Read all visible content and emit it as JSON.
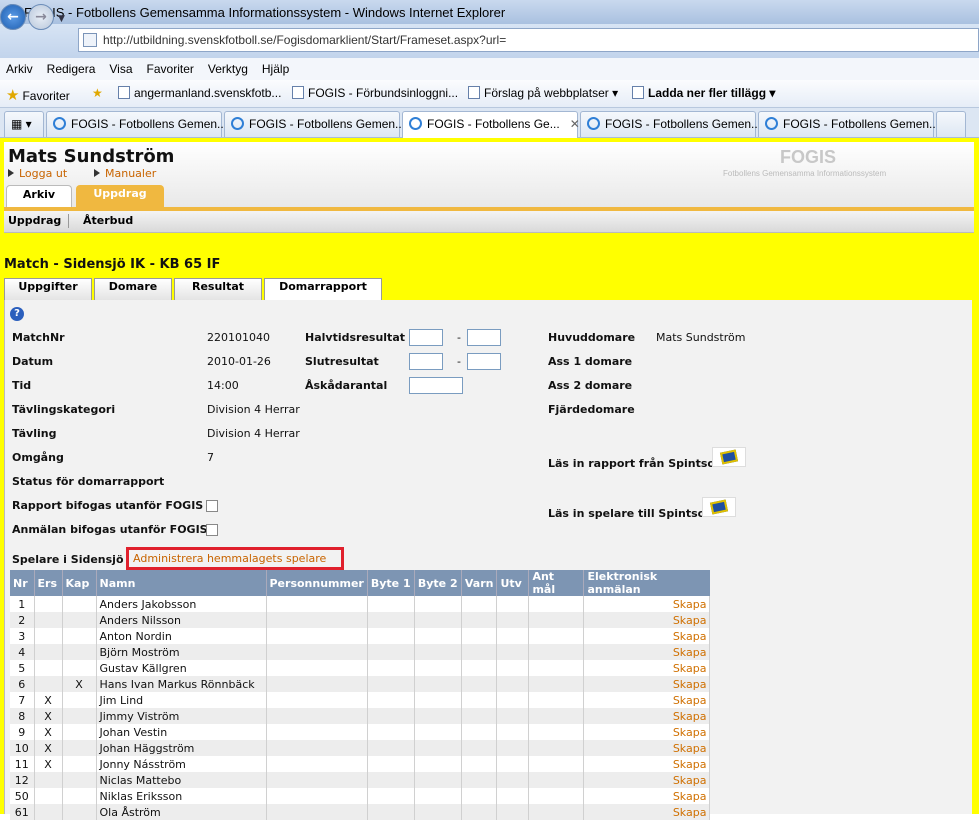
{
  "window": {
    "title": "FOGIS - Fotbollens Gemensamma Informationssystem - Windows Internet Explorer"
  },
  "address": {
    "url": "http://utbildning.svenskfotboll.se/Fogisdomarklient/Start/Frameset.aspx?url="
  },
  "menu": [
    "Arkiv",
    "Redigera",
    "Visa",
    "Favoriter",
    "Verktyg",
    "Hjälp"
  ],
  "favorites": {
    "label": "Favoriter",
    "items": [
      "angermanland.svenskfotb...",
      "FOGIS - Förbundsinloggni...",
      "Förslag på webbplatser ▾",
      "Ladda ner fler tillägg ▾"
    ]
  },
  "tabs": [
    "FOGIS - Fotbollens Gemen...",
    "FOGIS - Fotbollens Gemen...",
    "FOGIS - Fotbollens Ge...",
    "FOGIS - Fotbollens Gemen...",
    "FOGIS - Fotbollens Gemen..."
  ],
  "header": {
    "user": "Mats Sundström",
    "logout": "Logga ut",
    "manuals": "Manualer",
    "logo": "FOGIS",
    "logo_sub": "Fotbollens Gemensamma Informationssystem",
    "tab_arkiv": "Arkiv",
    "tab_uppdrag": "Uppdrag",
    "sub_uppdrag": "Uppdrag",
    "sub_aterbud": "Återbud"
  },
  "match": {
    "title": "Match - Sidensjö IK - KB 65 IF",
    "tabs": [
      "Uppgifter",
      "Domare",
      "Resultat",
      "Domarrapport"
    ]
  },
  "report": {
    "matchnr_label": "MatchNr",
    "matchnr": "220101040",
    "datum_label": "Datum",
    "datum": "2010-01-26",
    "tid_label": "Tid",
    "tid": "14:00",
    "kategori_label": "Tävlingskategori",
    "kategori": "Division 4 Herrar",
    "tavling_label": "Tävling",
    "tavling": "Division 4 Herrar",
    "omgang_label": "Omgång",
    "omgang": "7",
    "status_label": "Status för domarrapport",
    "rapport_label": "Rapport bifogas utanför FOGIS",
    "anmalan_label": "Anmälan bifogas utanför FOGIS",
    "halvtid_label": "Halvtidsresultat",
    "slut_label": "Slutresultat",
    "askadar_label": "Åskådarantal",
    "dash": "-",
    "huvud_label": "Huvuddomare",
    "huvud": "Mats Sundström",
    "ass1_label": "Ass 1 domare",
    "ass2_label": "Ass 2 domare",
    "fjarde_label": "Fjärdedomare",
    "las_rapport": "Läs in rapport från Spintso",
    "las_spelare": "Läs in spelare till Spintso",
    "players_label": "Spelare i Sidensjö IK",
    "admin_link": "Administrera hemmalagets spelare"
  },
  "players": {
    "headers": [
      "Nr",
      "Ers",
      "Kap",
      "Namn",
      "Personnummer",
      "Byte 1",
      "Byte 2",
      "Varn",
      "Utv",
      "Ant mål",
      "Elektronisk anmälan"
    ],
    "rows": [
      {
        "nr": "1",
        "ers": "",
        "kap": "",
        "namn": "Anders Jakobsson",
        "action": "Skapa"
      },
      {
        "nr": "2",
        "ers": "",
        "kap": "",
        "namn": "Anders Nilsson",
        "action": "Skapa"
      },
      {
        "nr": "3",
        "ers": "",
        "kap": "",
        "namn": "Anton Nordin",
        "action": "Skapa"
      },
      {
        "nr": "4",
        "ers": "",
        "kap": "",
        "namn": "Björn Moström",
        "action": "Skapa"
      },
      {
        "nr": "5",
        "ers": "",
        "kap": "",
        "namn": "Gustav Källgren",
        "action": "Skapa"
      },
      {
        "nr": "6",
        "ers": "",
        "kap": "X",
        "namn": "Hans Ivan Markus Rönnbäck",
        "action": "Skapa"
      },
      {
        "nr": "7",
        "ers": "X",
        "kap": "",
        "namn": "Jim Lind",
        "action": "Skapa"
      },
      {
        "nr": "8",
        "ers": "X",
        "kap": "",
        "namn": "Jimmy Viström",
        "action": "Skapa"
      },
      {
        "nr": "9",
        "ers": "X",
        "kap": "",
        "namn": "Johan Vestin",
        "action": "Skapa"
      },
      {
        "nr": "10",
        "ers": "X",
        "kap": "",
        "namn": "Johan Häggström",
        "action": "Skapa"
      },
      {
        "nr": "11",
        "ers": "X",
        "kap": "",
        "namn": "Jonny Násström",
        "action": "Skapa"
      },
      {
        "nr": "12",
        "ers": "",
        "kap": "",
        "namn": "Niclas Mattebo",
        "action": "Skapa"
      },
      {
        "nr": "50",
        "ers": "",
        "kap": "",
        "namn": "Niklas Eriksson",
        "action": "Skapa"
      },
      {
        "nr": "61",
        "ers": "",
        "kap": "",
        "namn": "Ola Åström",
        "action": "Skapa"
      }
    ]
  }
}
